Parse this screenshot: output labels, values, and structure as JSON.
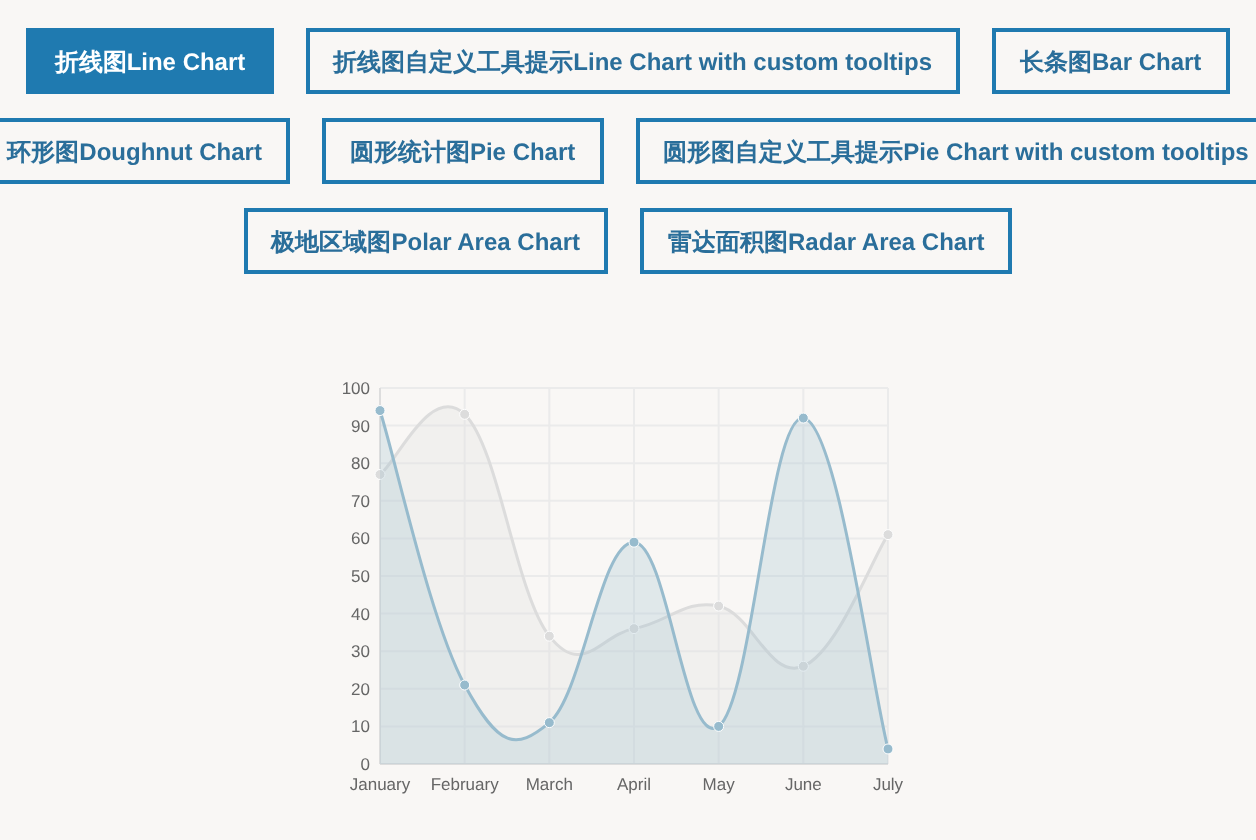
{
  "button_rows": [
    [
      {
        "label": "折线图Line Chart",
        "selected": true
      },
      {
        "label": "折线图自定义工具提示Line Chart with custom tooltips",
        "selected": false
      },
      {
        "label": "长条图Bar Chart",
        "selected": false
      }
    ],
    [
      {
        "label": "环形图Doughnut Chart",
        "selected": false
      },
      {
        "label": "圆形统计图Pie Chart",
        "selected": false
      },
      {
        "label": "圆形图自定义工具提示Pie Chart with custom tooltips",
        "selected": false
      }
    ],
    [
      {
        "label": "极地区域图Polar Area Chart",
        "selected": false
      },
      {
        "label": "雷达面积图Radar Area Chart",
        "selected": false
      }
    ]
  ],
  "chart": {
    "chart_data": {
      "type": "area",
      "categories": [
        "January",
        "February",
        "March",
        "April",
        "May",
        "June",
        "July"
      ],
      "series": [
        {
          "color": "#dcdcdc",
          "values": [
            77,
            93,
            34,
            36,
            42,
            26,
            61
          ]
        },
        {
          "color": "#97bbcd",
          "values": [
            94,
            21,
            11,
            59,
            10,
            92,
            4
          ]
        }
      ],
      "ylim": [
        0,
        100
      ],
      "grid": true,
      "yticks": [
        0,
        10,
        20,
        30,
        40,
        50,
        60,
        70,
        80,
        90,
        100
      ]
    }
  }
}
